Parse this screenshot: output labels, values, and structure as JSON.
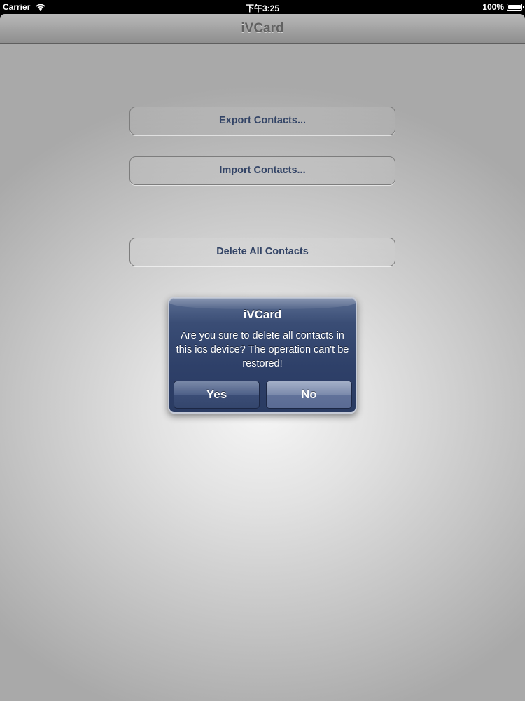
{
  "status_bar": {
    "carrier": "Carrier",
    "time": "下午3:25",
    "battery_text": "100%",
    "battery_level": 1.0,
    "icons": [
      "wifi-icon",
      "battery-icon"
    ]
  },
  "nav": {
    "title": "iVCard"
  },
  "main": {
    "export_label": "Export Contacts...",
    "import_label": "Import Contacts...",
    "delete_label": "Delete All Contacts"
  },
  "alert": {
    "title": "iVCard",
    "message": "Are you sure to delete all contacts in this ios device? The operation can't be restored!",
    "yes_label": "Yes",
    "no_label": "No"
  },
  "colors": {
    "button_text": "#334466",
    "alert_background": "#2e4069",
    "nav_title": "#616161"
  }
}
